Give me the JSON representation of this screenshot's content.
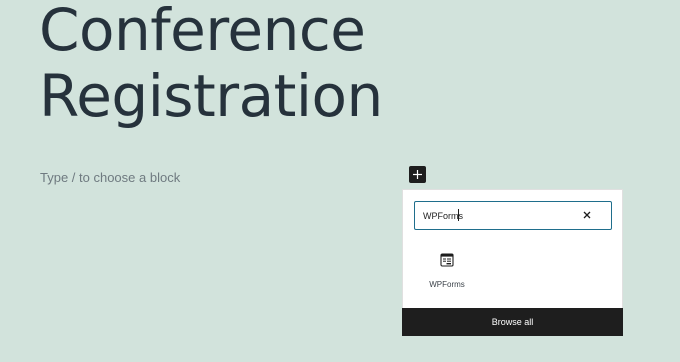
{
  "page": {
    "title_line1": "Conference",
    "title_line2": "Registration",
    "block_placeholder": "Type / to choose a block"
  },
  "inserter": {
    "search_value": "WPForms",
    "results": [
      {
        "label": "WPForms",
        "icon": "wpforms-icon"
      }
    ],
    "browse_all_label": "Browse all"
  },
  "icons": {
    "add": "plus-icon",
    "clear": "close-icon"
  },
  "colors": {
    "background": "#d2e3dc",
    "title_text": "#26323c",
    "search_border": "#1f6e8c",
    "dark_button": "#1e1e1e"
  }
}
